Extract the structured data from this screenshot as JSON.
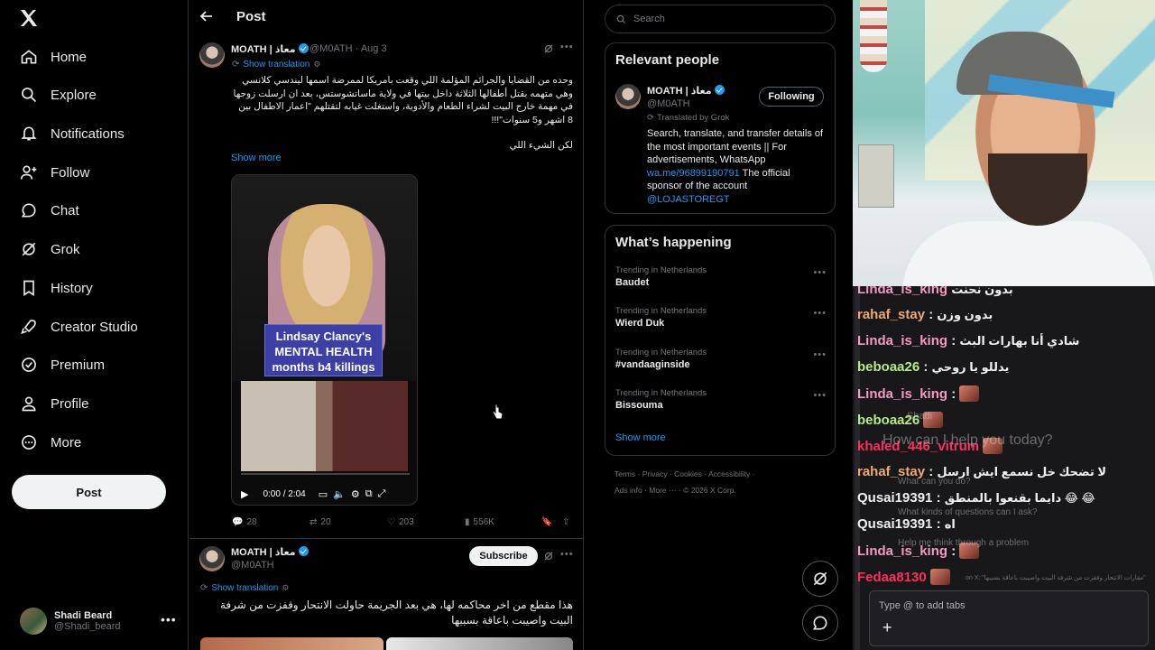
{
  "nav": {
    "items": [
      {
        "label": "Home",
        "icon": "home-icon"
      },
      {
        "label": "Explore",
        "icon": "search-icon"
      },
      {
        "label": "Notifications",
        "icon": "bell-icon"
      },
      {
        "label": "Follow",
        "icon": "person-add-icon"
      },
      {
        "label": "Chat",
        "icon": "chat-icon"
      },
      {
        "label": "Grok",
        "icon": "grok-icon"
      },
      {
        "label": "History",
        "icon": "bookmark-icon"
      },
      {
        "label": "Creator Studio",
        "icon": "rocket-icon"
      },
      {
        "label": "Premium",
        "icon": "verified-icon"
      },
      {
        "label": "Profile",
        "icon": "person-icon"
      },
      {
        "label": "More",
        "icon": "more-circle-icon"
      }
    ],
    "post_label": "Post",
    "account": {
      "name": "Shadi Beard",
      "handle": "@Shadi_beard"
    }
  },
  "main": {
    "header_title": "Post",
    "tweet1": {
      "name": "MOATH | معاذ",
      "handle": "@M0ATH",
      "date": "· Aug 3",
      "show_translation": "Show translation",
      "body": "وحده من القضايا والجرائم المؤلمة اللي وقعت بامريكا لممرضة اسمها ليندسي كلانسي وهي متهمه بقتل أطفالها الثلاثة داخل بيتها في ولاية ماساتشوستس، بعد ان ارسلت زوجها في مهمة خارج البيت لشراء الطعام والأدوية، واستغلت غيابه لتقتلهم \"اعمار الاطفال بين 8 اشهر و5 سنوات\"!!!",
      "body2": "لكن الشيء اللي",
      "show_more": "Show more",
      "video_caption": "Lindsay Clancy's MENTAL HEALTH months b4 killings",
      "video_time": "0:00 / 2:04",
      "replies": "28",
      "reposts": "20",
      "likes": "203",
      "views": "556K"
    },
    "tweet2": {
      "name": "MOATH | معاذ",
      "handle": "@M0ATH",
      "subscribe": "Subscribe",
      "show_translation": "Show translation",
      "body": "هذا مقطع من اخر محاكمه لها، هي بعد الجريمة حاولت الانتحار وقفزت من شرفة البيت واصيبت باعاقة بسببها"
    }
  },
  "right": {
    "search_placeholder": "Search",
    "relevant": {
      "title": "Relevant people",
      "name": "MOATH | معاذ",
      "handle": "@M0ATH",
      "follow": "Following",
      "translated": "Translated by Grok",
      "bio": "Search, translate, and transfer details of the most important events || For advertisements, WhatsApp ",
      "bio_link": "wa.me/96899190791",
      "bio_rest": " The official sponsor of the account ",
      "bio_link2": "@LOJASTOREGT"
    },
    "happening": {
      "title": "What’s happening",
      "trends": [
        {
          "context": "Trending in Netherlands",
          "name": "Baudet"
        },
        {
          "context": "Trending in Netherlands",
          "name": "Wierd Duk"
        },
        {
          "context": "Trending in Netherlands",
          "name": "#vandaaginside"
        },
        {
          "context": "Trending in Netherlands",
          "name": "Bissouma"
        }
      ],
      "show_more": "Show more"
    },
    "footer": {
      "line1": [
        "Terms",
        "Privacy",
        "Cookies",
        "Accessibility"
      ],
      "line2": [
        "Ads info",
        "More ···",
        "© 2026 X Corp."
      ]
    }
  },
  "chat": {
    "top_partial": {
      "user": "Linda_is_king",
      "msg": "بدون نحنت"
    },
    "lines": [
      {
        "user": "rahaf_stay",
        "color": "#f0a870",
        "msg": "بدون وزن"
      },
      {
        "user": "Linda_is_king",
        "color": "#f49ac1",
        "msg": "شادي أنا بهارات البث"
      },
      {
        "user": "beboaa26",
        "color": "#b8e986",
        "msg": "يدللو يا روحي"
      },
      {
        "user": "Linda_is_king",
        "color": "#f49ac1",
        "msg": ""
      },
      {
        "user": "beboaa26",
        "color": "#b8e986",
        "msg": ""
      },
      {
        "user": "khaled_446_vitrum",
        "color": "#ff2e5c",
        "msg": ""
      },
      {
        "user": "rahaf_stay",
        "color": "#f0a870",
        "msg": "لا تضحك خل نسمع ايش ارسل"
      },
      {
        "user": "Qusai19391",
        "color": "#efeff1",
        "msg": "دايما بقنعوا بالمنطق 😂 😂"
      },
      {
        "user": "Qusai19391",
        "color": "#efeff1",
        "msg": "اه"
      },
      {
        "user": "Linda_is_king",
        "color": "#f49ac1",
        "msg": ""
      },
      {
        "user": "Fedaa8130",
        "color": "#ff2e5c",
        "msg": ""
      }
    ],
    "ghost": {
      "g1": "How can I help you today?",
      "g2": "What can you do?",
      "g3": "What kinds of questions can I ask?",
      "g4": "Help me think through a problem",
      "g5": "Shadi",
      "g6": "on X: \"مقارات الانتحار وقفزت من شرفة البيت واصيبت باعاقة بسببها\""
    },
    "input_placeholder": "Type @ to add tabs"
  },
  "colors": {
    "accent": "#1d9bf0",
    "bg": "#000000",
    "border": "#2f3336",
    "muted": "#71767b"
  }
}
